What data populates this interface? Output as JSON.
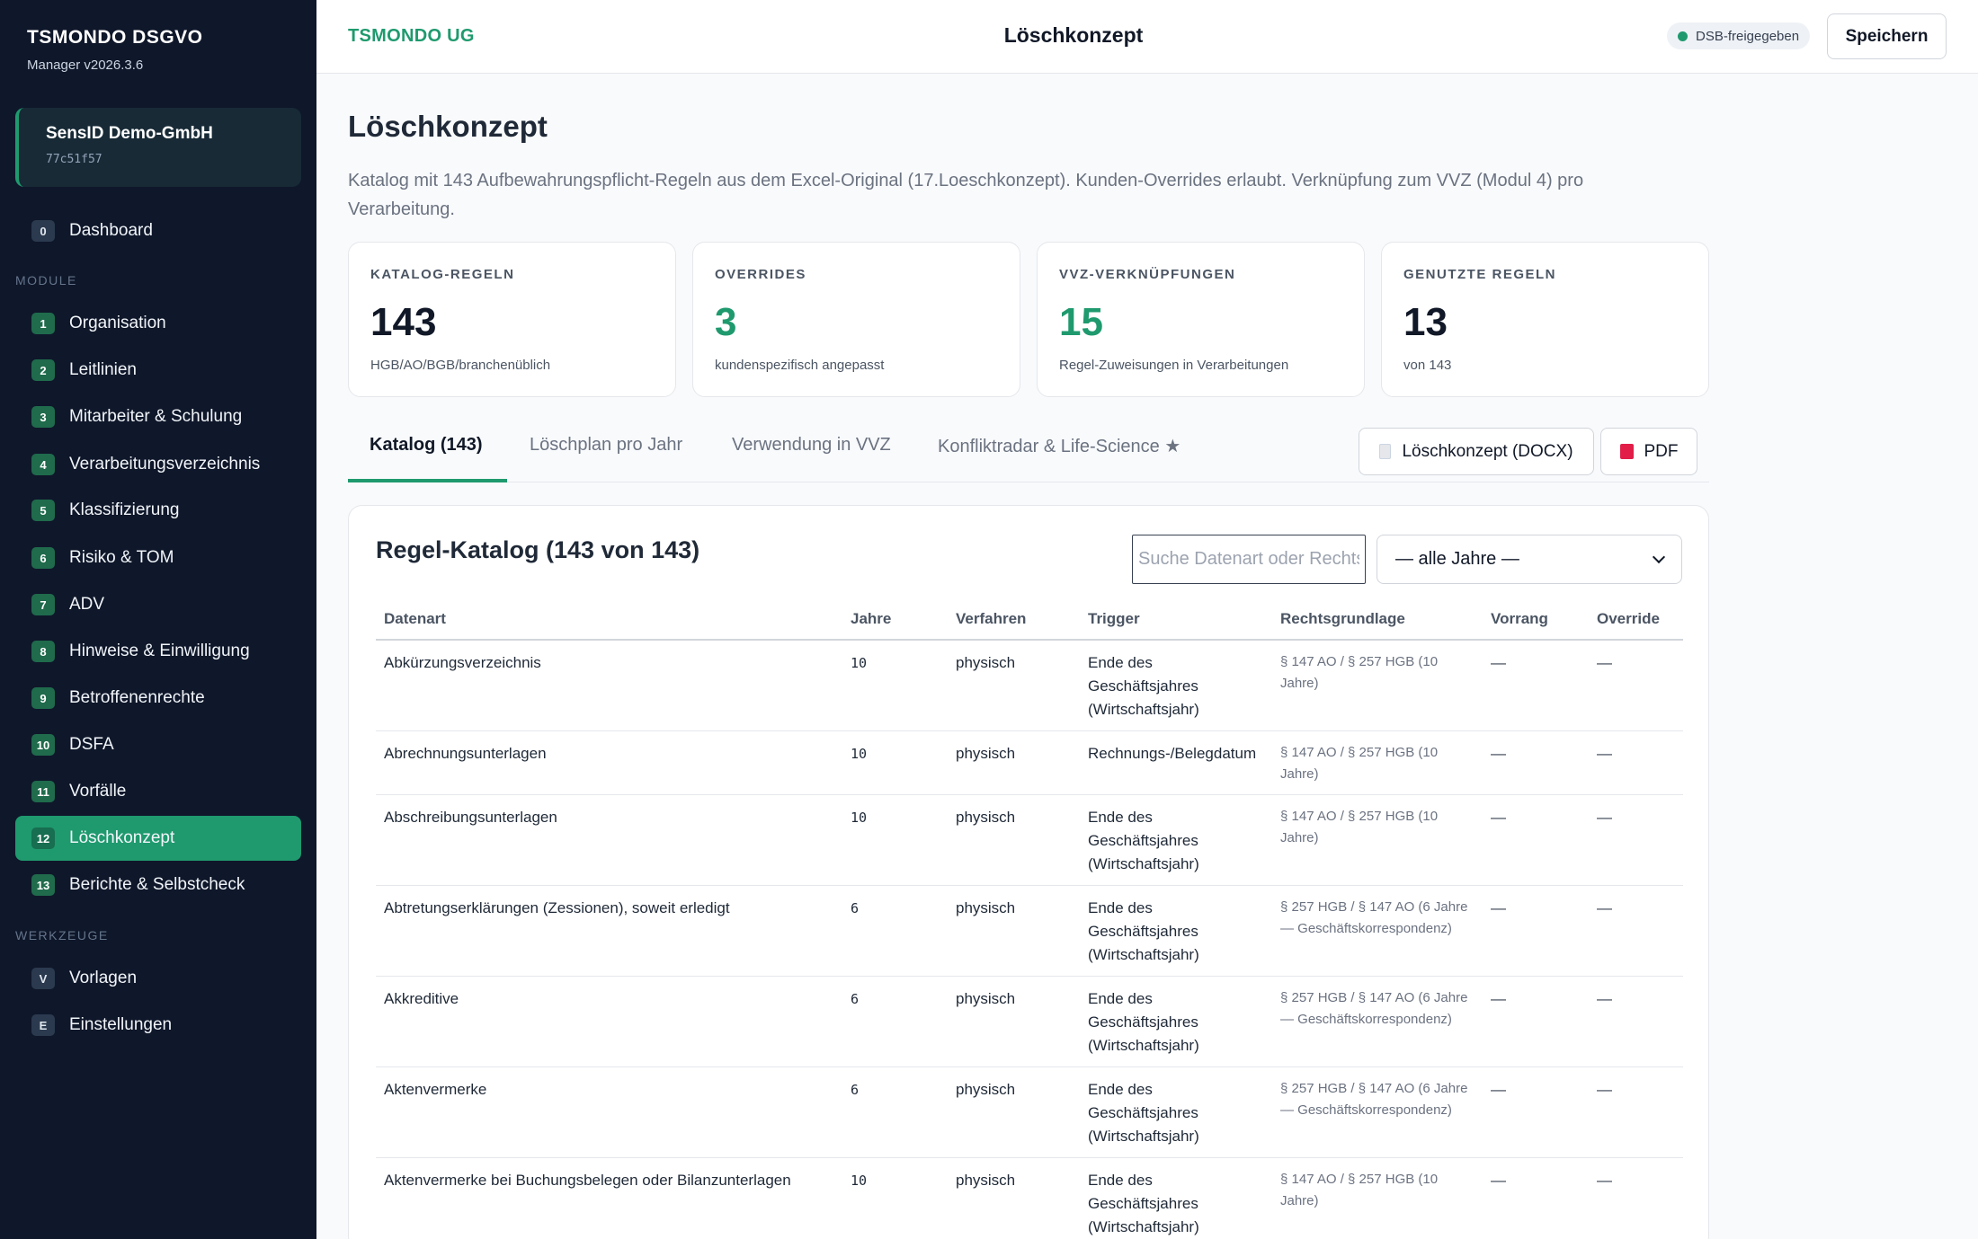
{
  "app": {
    "title": "TSMONDO DSGVO",
    "version": "Manager v2026.3.6"
  },
  "org": {
    "name": "SensID Demo-GmbH",
    "id": "77c51f57"
  },
  "sidebar": {
    "dashboard": {
      "badge": "0",
      "label": "Dashboard"
    },
    "modules_heading": "MODULE",
    "modules": [
      {
        "badge": "1",
        "label": "Organisation"
      },
      {
        "badge": "2",
        "label": "Leitlinien"
      },
      {
        "badge": "3",
        "label": "Mitarbeiter & Schulung"
      },
      {
        "badge": "4",
        "label": "Verarbeitungsverzeichnis"
      },
      {
        "badge": "5",
        "label": "Klassifizierung"
      },
      {
        "badge": "6",
        "label": "Risiko & TOM"
      },
      {
        "badge": "7",
        "label": "ADV"
      },
      {
        "badge": "8",
        "label": "Hinweise & Einwilligung"
      },
      {
        "badge": "9",
        "label": "Betroffenenrechte"
      },
      {
        "badge": "10",
        "label": "DSFA"
      },
      {
        "badge": "11",
        "label": "Vorfälle"
      },
      {
        "badge": "12",
        "label": "Löschkonzept"
      },
      {
        "badge": "13",
        "label": "Berichte & Selbstcheck"
      }
    ],
    "tools_heading": "WERKZEUGE",
    "tools": [
      {
        "badge": "V",
        "label": "Vorlagen"
      },
      {
        "badge": "E",
        "label": "Einstellungen"
      }
    ]
  },
  "topbar": {
    "org": "TSMONDO UG",
    "title": "Löschkonzept",
    "status": "DSB-freigegeben",
    "save_label": "Speichern"
  },
  "page": {
    "title": "Löschkonzept",
    "description": "Katalog mit 143 Aufbewahrungspflicht-Regeln aus dem Excel-Original (17.Loeschkonzept). Kunden-Overrides erlaubt. Verknüpfung zum VVZ (Modul 4) pro Verarbeitung."
  },
  "stats": [
    {
      "label": "KATALOG-REGELN",
      "value": "143",
      "sub": "HGB/AO/BGB/branchenüblich"
    },
    {
      "label": "OVERRIDES",
      "value": "3",
      "sub": "kundenspezifisch angepasst"
    },
    {
      "label": "VVZ-VERKNÜPFUNGEN",
      "value": "15",
      "sub": "Regel-Zuweisungen in Verarbeitungen"
    },
    {
      "label": "GENUTZTE REGELN",
      "value": "13",
      "sub": "von 143"
    }
  ],
  "tabs": [
    "Katalog (143)",
    "Löschplan pro Jahr",
    "Verwendung in VVZ",
    "Konfliktradar & Life-Science ★"
  ],
  "actions": {
    "docx": "Löschkonzept (DOCX)",
    "pdf": "PDF"
  },
  "catalog": {
    "title": "Regel-Katalog (143 von 143)",
    "search_placeholder": "Suche Datenart oder Rechtsgrundlage",
    "year_filter": "— alle Jahre —",
    "columns": [
      "Datenart",
      "Jahre",
      "Verfahren",
      "Trigger",
      "Rechtsgrundlage",
      "Vorrang",
      "Override"
    ],
    "rows": [
      [
        "Abkürzungsverzeichnis",
        "10",
        "physisch",
        "Ende des Geschäftsjahres (Wirtschaftsjahr)",
        "§ 147 AO / § 257 HGB (10 Jahre)",
        "—",
        "—"
      ],
      [
        "Abrechnungsunterlagen",
        "10",
        "physisch",
        "Rechnungs-/Belegdatum",
        "§ 147 AO / § 257 HGB (10 Jahre)",
        "—",
        "—"
      ],
      [
        "Abschreibungsunterlagen",
        "10",
        "physisch",
        "Ende des Geschäftsjahres (Wirtschaftsjahr)",
        "§ 147 AO / § 257 HGB (10 Jahre)",
        "—",
        "—"
      ],
      [
        "Abtretungserklärungen (Zessionen), soweit erledigt",
        "6",
        "physisch",
        "Ende des Geschäftsjahres (Wirtschaftsjahr)",
        "§ 257 HGB / § 147 AO (6 Jahre — Geschäftskorrespondenz)",
        "—",
        "—"
      ],
      [
        "Akkreditive",
        "6",
        "physisch",
        "Ende des Geschäftsjahres (Wirtschaftsjahr)",
        "§ 257 HGB / § 147 AO (6 Jahre — Geschäftskorrespondenz)",
        "—",
        "—"
      ],
      [
        "Aktenvermerke",
        "6",
        "physisch",
        "Ende des Geschäftsjahres (Wirtschaftsjahr)",
        "§ 257 HGB / § 147 AO (6 Jahre — Geschäftskorrespondenz)",
        "—",
        "—"
      ],
      [
        "Aktenvermerke bei Buchungsbelegen oder Bilanzunterlagen",
        "10",
        "physisch",
        "Ende des Geschäftsjahres (Wirtschaftsjahr)",
        "§ 147 AO / § 257 HGB (10 Jahre)",
        "—",
        "—"
      ]
    ]
  }
}
